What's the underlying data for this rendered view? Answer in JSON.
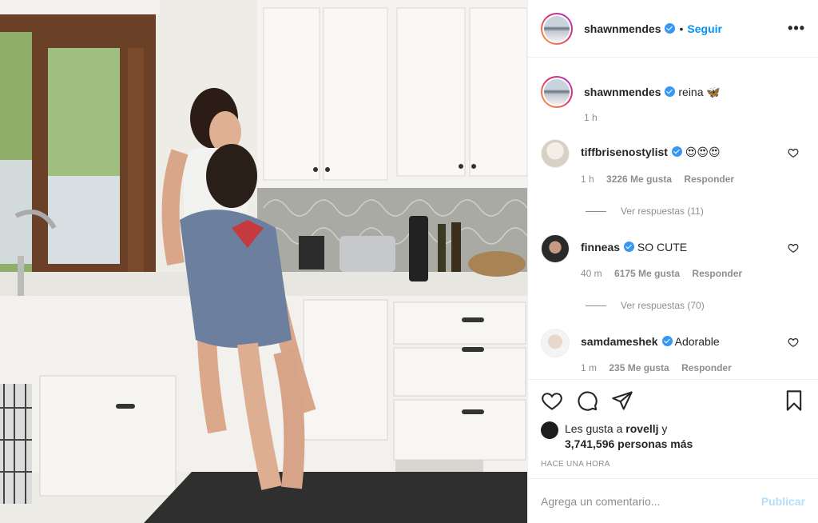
{
  "post": {
    "username": "shawnmendes",
    "follow_label": "Seguir",
    "dot": "•",
    "more_label": "•••",
    "photo_alt": "Shawn Mendes and Camila Cabello in a kitchen"
  },
  "caption": {
    "username": "shawnmendes",
    "text": "reina",
    "emoji": "🦋",
    "time": "1 h"
  },
  "comments": [
    {
      "username": "tiffbrisenostylist",
      "text": "😍😍😍",
      "time": "1 h",
      "likes": "3226 Me gusta",
      "reply": "Responder",
      "view_replies": "Ver respuestas (11)"
    },
    {
      "username": "finneas",
      "text": "SO CUTE",
      "time": "40 m",
      "likes": "6175 Me gusta",
      "reply": "Responder",
      "view_replies": "Ver respuestas (70)"
    },
    {
      "username": "samdameshek",
      "text": "Adorable",
      "time": "1 m",
      "likes": "235 Me gusta",
      "reply": "Responder"
    }
  ],
  "likes": {
    "prefix": "Les gusta a ",
    "user": "rovellj",
    "suffix": " y",
    "count": "3,741,596 personas más"
  },
  "posted_ago": "HACE UNA HORA",
  "add_comment": {
    "placeholder": "Agrega un comentario...",
    "publish_label": "Publicar"
  },
  "colors": {
    "link": "#0095f6",
    "muted": "#8e8e8e",
    "verified": "#3897f0",
    "publish_disabled": "#b2dffc"
  },
  "icons": [
    "heart-icon",
    "comment-icon",
    "share-icon",
    "bookmark-icon",
    "verified-icon",
    "more-options-icon",
    "like-comment-icon"
  ]
}
